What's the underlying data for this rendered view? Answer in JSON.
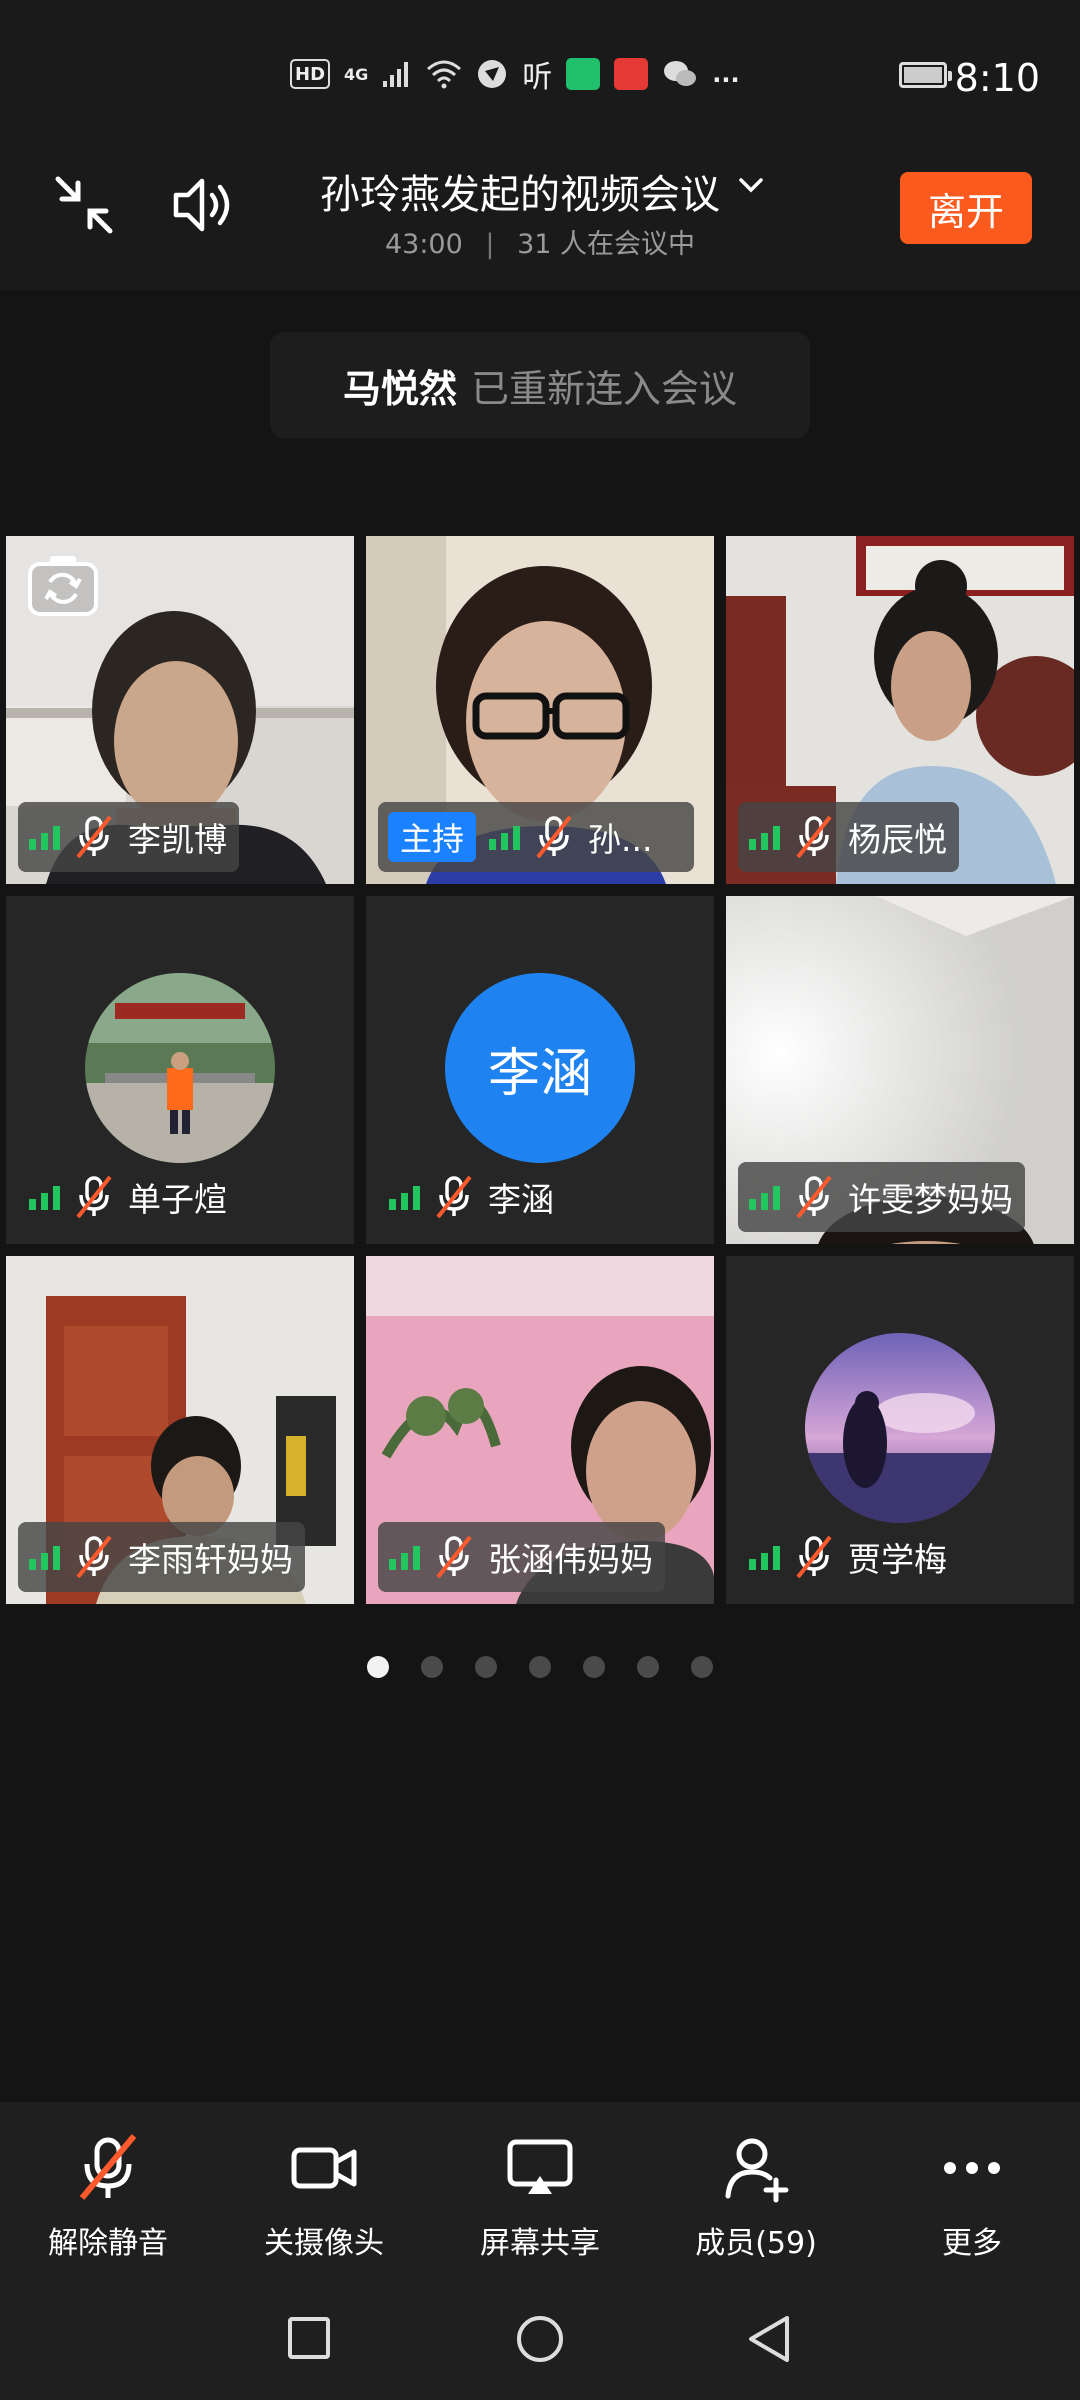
{
  "status_bar": {
    "time": "8:10",
    "indicators": [
      "HD",
      "4G",
      "signal-icon",
      "wifi-icon",
      "app-icon",
      "听",
      "app-icon",
      "app-icon",
      "wechat-icon",
      "..."
    ]
  },
  "header": {
    "title": "孙玲燕发起的视频会议",
    "elapsed": "43:00",
    "attendance": "31 人在会议中",
    "leave_label": "离开"
  },
  "toast": {
    "name": "马悦然",
    "message": "已重新连入会议"
  },
  "participants": [
    {
      "name": "李凯博",
      "muted": true,
      "video": true
    },
    {
      "name": "孙...",
      "muted": true,
      "video": true,
      "host_badge": "主持"
    },
    {
      "name": "杨辰悦",
      "muted": true,
      "video": true
    },
    {
      "name": "单子煊",
      "muted": true,
      "video": false,
      "avatar": "photo"
    },
    {
      "name": "李涵",
      "muted": true,
      "video": false,
      "avatar_text": "李涵"
    },
    {
      "name": "许雯梦妈妈",
      "muted": true,
      "video": true
    },
    {
      "name": "李雨轩妈妈",
      "muted": true,
      "video": true
    },
    {
      "name": "张涵伟妈妈",
      "muted": true,
      "video": true
    },
    {
      "name": "贾学梅",
      "muted": true,
      "video": false,
      "avatar": "photo"
    }
  ],
  "pagination": {
    "total": 7,
    "current": 1
  },
  "toolbar": {
    "unmute": "解除静音",
    "camera_off": "关摄像头",
    "share_screen": "屏幕共享",
    "members": "成员(59)",
    "more": "更多"
  },
  "colors": {
    "accent_orange": "#fa5a1e",
    "host_blue": "#1a82ff",
    "signal_green": "#22c55e",
    "mute_red": "#ff5a2d"
  }
}
